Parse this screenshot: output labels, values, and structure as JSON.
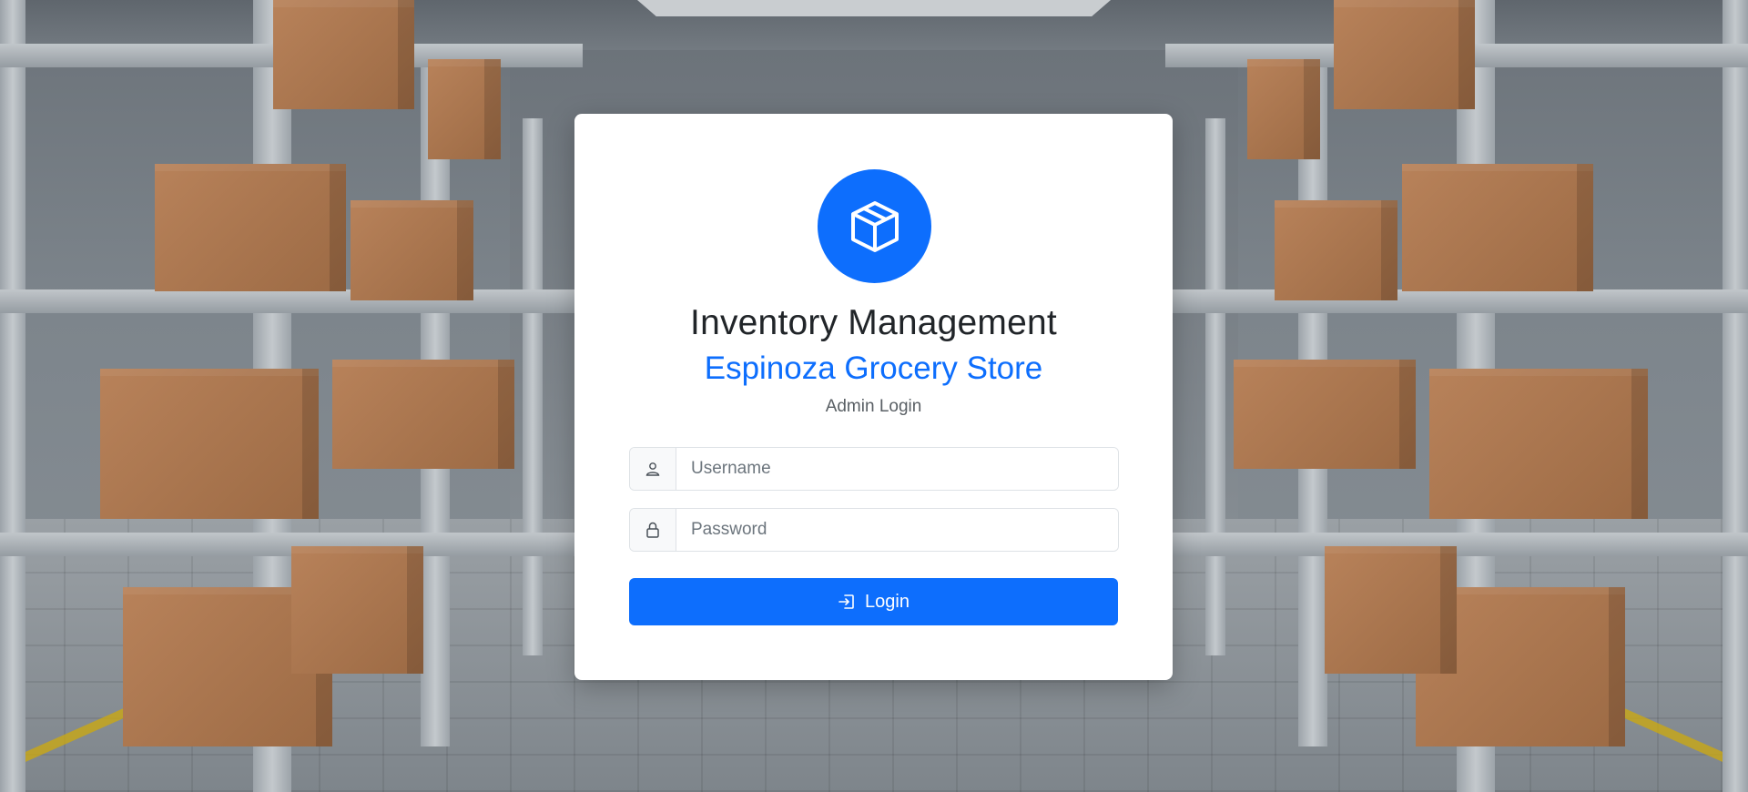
{
  "login": {
    "title": "Inventory Management",
    "store_name": "Espinoza Grocery Store",
    "caption": "Admin Login",
    "username_placeholder": "Username",
    "password_placeholder": "Password",
    "login_label": "Login"
  },
  "icons": {
    "logo": "box-icon",
    "username": "user-icon",
    "password": "lock-icon",
    "login": "login-arrow-icon"
  },
  "colors": {
    "primary": "#0d6efd",
    "card": "#ffffff",
    "title": "#212529"
  }
}
